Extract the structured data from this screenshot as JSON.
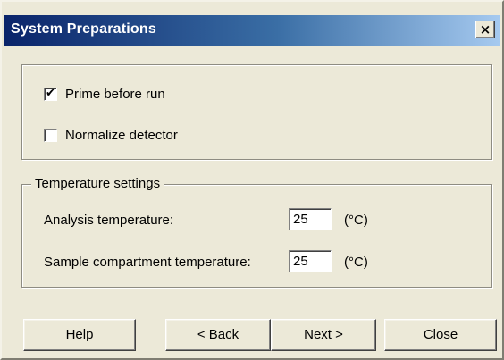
{
  "window": {
    "title": "System Preparations",
    "close_glyph": "×"
  },
  "options": {
    "prime_before_run": {
      "label": "Prime before run",
      "checked": true
    },
    "normalize_detector": {
      "label": "Normalize detector",
      "checked": false
    }
  },
  "temperature": {
    "group_label": "Temperature settings",
    "analysis": {
      "label": "Analysis temperature:",
      "value": "25",
      "unit": "(°C)"
    },
    "sample_compartment": {
      "label": "Sample compartment temperature:",
      "value": "25",
      "unit": "(°C)"
    }
  },
  "buttons": {
    "help": "Help",
    "back": "< Back",
    "next": "Next >",
    "close": "Close"
  },
  "icons": {
    "checkmark": "✔"
  }
}
